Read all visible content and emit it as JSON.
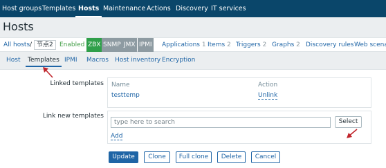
{
  "topnav": {
    "items": [
      "Host groups",
      "Templates",
      "Hosts",
      "Maintenance",
      "Actions",
      "Discovery",
      "IT services"
    ]
  },
  "page": {
    "title": "Hosts"
  },
  "subnav": {
    "all_hosts": "All hosts",
    "separator": "/",
    "host_name": "节点2",
    "status": "Enabled",
    "availability": [
      "ZBX",
      "SNMP",
      "JMX",
      "IPMI"
    ],
    "links": [
      {
        "label": "Applications",
        "count": "1"
      },
      {
        "label": "Items",
        "count": "2"
      },
      {
        "label": "Triggers",
        "count": "2"
      },
      {
        "label": "Graphs",
        "count": "2"
      },
      {
        "label": "Discovery rules",
        "count": ""
      },
      {
        "label": "Web scenar",
        "count": ""
      }
    ]
  },
  "tabs": [
    "Host",
    "Templates",
    "IPMI",
    "Macros",
    "Host inventory",
    "Encryption"
  ],
  "linked_templates": {
    "label": "Linked templates",
    "col_name": "Name",
    "col_action": "Action",
    "rows": [
      {
        "name": "testtemp",
        "action": "Unlink"
      }
    ]
  },
  "link_new": {
    "label": "Link new templates",
    "placeholder": "type here to search",
    "select_label": "Select",
    "add_label": "Add"
  },
  "buttons": {
    "update": "Update",
    "clone": "Clone",
    "full_clone": "Full clone",
    "delete": "Delete",
    "cancel": "Cancel"
  },
  "colors": {
    "header_bg": "#0a466a",
    "link": "#1f65a6",
    "available_green": "#2f9f4a",
    "unknown_grey": "#8e9ba2",
    "enabled_text": "#429e47",
    "annotation_arrow": "#c0242b"
  },
  "icons": [
    "annotation-arrow-icon"
  ]
}
